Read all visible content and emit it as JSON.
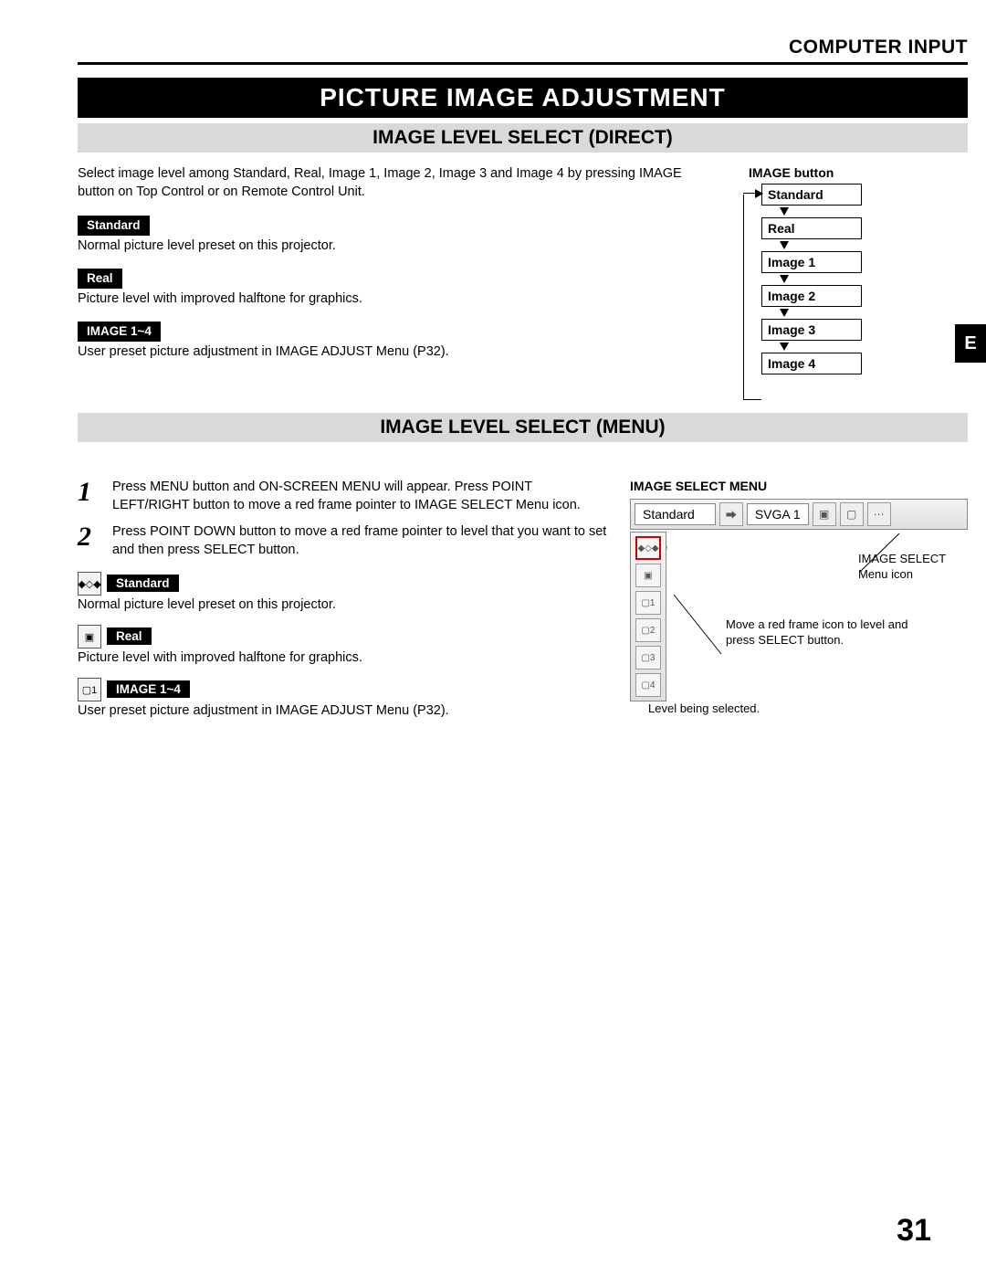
{
  "header": "COMPUTER INPUT",
  "title": "PICTURE IMAGE ADJUSTMENT",
  "side_tab": "E",
  "page_number": "31",
  "direct": {
    "heading": "IMAGE LEVEL SELECT (DIRECT)",
    "intro": "Select image level among Standard, Real, Image 1, Image 2, Image 3 and Image 4 by pressing IMAGE button on Top Control or on Remote Control Unit.",
    "items": [
      {
        "tag": "Standard",
        "desc": "Normal picture level preset on this projector."
      },
      {
        "tag": "Real",
        "desc": "Picture level with improved halftone for graphics."
      },
      {
        "tag": "IMAGE 1~4",
        "desc": "User preset picture adjustment in IMAGE ADJUST Menu (P32)."
      }
    ],
    "diagram": {
      "title": "IMAGE button",
      "levels": [
        "Standard",
        "Real",
        "Image 1",
        "Image 2",
        "Image 3",
        "Image 4"
      ]
    }
  },
  "menu": {
    "heading": "IMAGE LEVEL SELECT (MENU)",
    "steps": [
      "Press MENU button and ON-SCREEN MENU will appear.  Press POINT LEFT/RIGHT button to move a red frame pointer to IMAGE SELECT Menu icon.",
      "Press POINT DOWN button to move a red frame pointer to level that you want to set and then press SELECT button."
    ],
    "items": [
      {
        "tag": "Standard",
        "desc": "Normal picture level preset on this projector."
      },
      {
        "tag": "Real",
        "desc": "Picture level with improved halftone for graphics."
      },
      {
        "tag": "IMAGE 1~4",
        "desc": "User preset picture adjustment in IMAGE ADJUST Menu (P32)."
      }
    ],
    "screenshot": {
      "title": "IMAGE SELECT MENU",
      "field": "Standard",
      "mode": "SVGA 1",
      "callout1": "IMAGE SELECT Menu icon",
      "callout2": "Move a red frame icon to level and press SELECT button.",
      "callout3": "Level being selected."
    }
  }
}
